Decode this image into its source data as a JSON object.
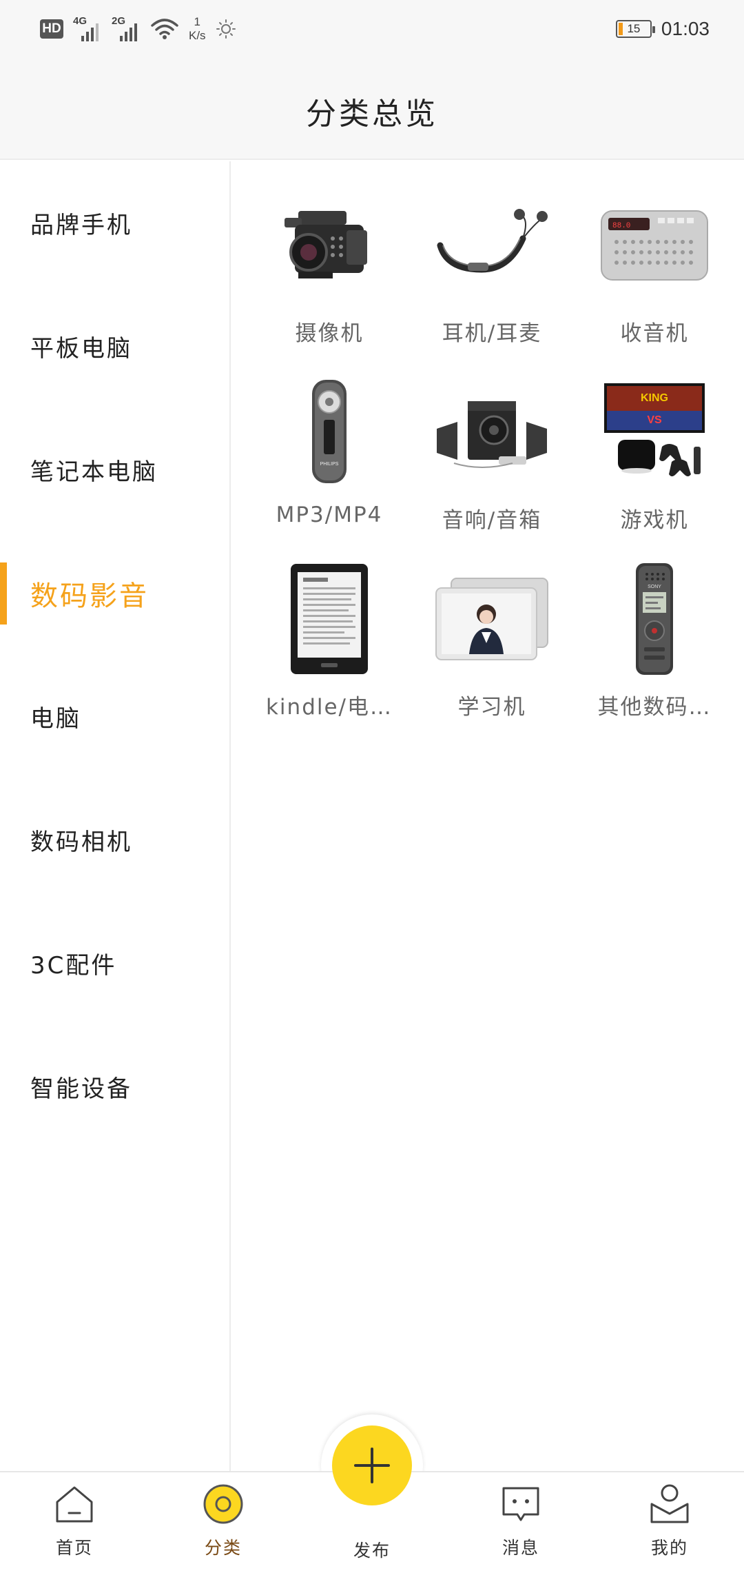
{
  "status_bar": {
    "hd": "HD",
    "net1": "4G",
    "net2": "2G",
    "speed_value": "1",
    "speed_unit": "K/s",
    "battery": "15",
    "time": "01:03"
  },
  "header": {
    "title": "分类总览"
  },
  "sidebar": {
    "items": [
      {
        "label": "品牌手机"
      },
      {
        "label": "平板电脑"
      },
      {
        "label": "笔记本电脑"
      },
      {
        "label": "数码影音"
      },
      {
        "label": "电脑"
      },
      {
        "label": "数码相机"
      },
      {
        "label": "3C配件"
      },
      {
        "label": "智能设备"
      }
    ],
    "active_index": 3
  },
  "grid": {
    "items": [
      {
        "label": "摄像机",
        "icon": "video-camera-icon"
      },
      {
        "label": "耳机/耳麦",
        "icon": "headphones-icon"
      },
      {
        "label": "收音机",
        "icon": "radio-icon"
      },
      {
        "label": "MP3/MP4",
        "icon": "mp3-player-icon"
      },
      {
        "label": "音响/音箱",
        "icon": "speakers-icon"
      },
      {
        "label": "游戏机",
        "icon": "game-console-icon"
      },
      {
        "label": "kindle/电…",
        "icon": "ebook-reader-icon"
      },
      {
        "label": "学习机",
        "icon": "tablet-learning-icon"
      },
      {
        "label": "其他数码…",
        "icon": "voice-recorder-icon"
      }
    ]
  },
  "bottom_nav": {
    "home": "首页",
    "category": "分类",
    "publish": "发布",
    "messages": "消息",
    "mine": "我的"
  },
  "colors": {
    "accent": "#f5a21b",
    "fab": "#fcd720"
  }
}
